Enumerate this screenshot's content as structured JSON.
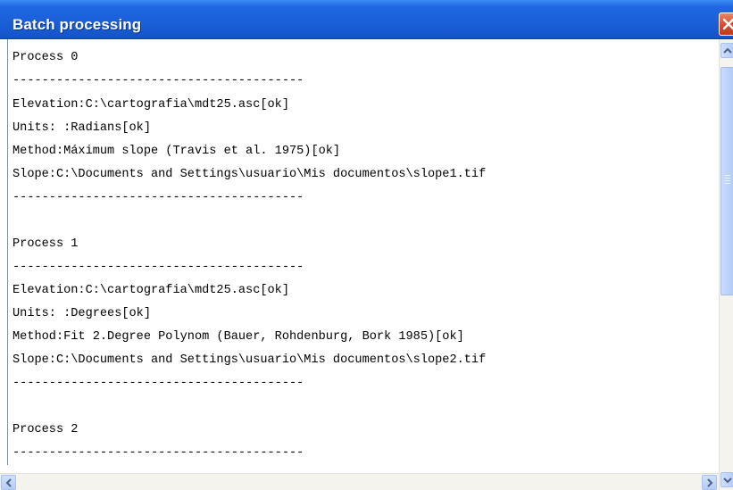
{
  "window": {
    "title": "Batch processing",
    "close_icon": "close-icon"
  },
  "output": {
    "lines": [
      "Process 0",
      "----------------------------------------",
      "Elevation:C:\\cartografia\\mdt25.asc[ok]",
      "Units: :Radians[ok]",
      "Method:Máximum slope (Travis et al. 1975)[ok]",
      "Slope:C:\\Documents and Settings\\usuario\\Mis documentos\\slope1.tif",
      "----------------------------------------",
      "",
      "Process 1",
      "----------------------------------------",
      "Elevation:C:\\cartografia\\mdt25.asc[ok]",
      "Units: :Degrees[ok]",
      "Method:Fit 2.Degree Polynom (Bauer, Rohdenburg, Bork 1985)[ok]",
      "Slope:C:\\Documents and Settings\\usuario\\Mis documentos\\slope2.tif",
      "----------------------------------------",
      "",
      "Process 2",
      "----------------------------------------"
    ]
  },
  "scrollbars": {
    "vertical": {
      "up_icon": "arrow-up-icon",
      "down_icon": "arrow-down-icon"
    },
    "horizontal": {
      "left_icon": "arrow-left-icon",
      "right_icon": "arrow-right-icon"
    }
  },
  "colors": {
    "titlebar": "#1f67e2",
    "close_button": "#d94a2a",
    "scroll_thumb": "#bed3fa"
  }
}
